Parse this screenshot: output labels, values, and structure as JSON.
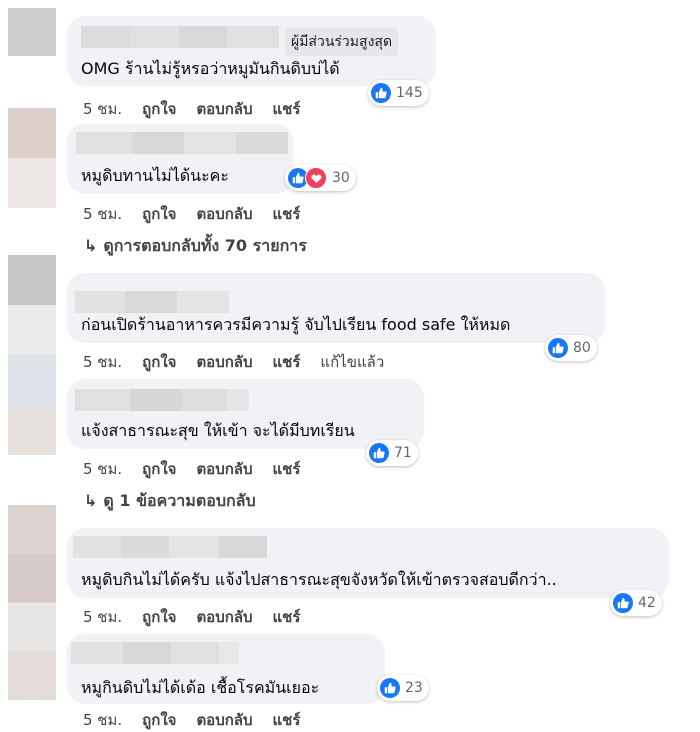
{
  "actions": {
    "time": "5 ชม.",
    "like": "ถูกใจ",
    "reply": "ตอบกลับ",
    "share": "แชร์",
    "edited": "แก้ไขแล้ว"
  },
  "icons": {
    "like": "thumbs-up-icon",
    "love": "heart-icon",
    "reply_arrow": "reply-arrow-icon"
  },
  "colors": {
    "like": "#1877f2",
    "love": "#f33e58",
    "bubble": "#f0f2f5"
  },
  "comments": [
    {
      "badge": "ผู้มีส่วนร่วมสูงสุด",
      "text": "OMG ร้านไม่รู้หรอว่าหมูมันกินดิบบ่ได้",
      "reactions": "145"
    },
    {
      "text": "หมูดิบทานไม่ได้นะคะ",
      "reactions": "30",
      "replies": "ดูการตอบกลับทั้ง 70 รายการ"
    },
    {
      "text": "ก่อนเปิดร้านอาหารควรมีความรู้ จับไปเรียน food safe ให้หมด",
      "reactions": "80"
    },
    {
      "text": "แจ้งสาธารณะสุข ให้เข้า จะได้มีบทเรียน",
      "reactions": "71",
      "replies": "ดู 1 ข้อความตอบกลับ"
    },
    {
      "text": "หมูดิบกินไม่ได้ครับ แจ้งไปสาธารณะสุขจังหวัดให้เข้าตรวจสอบดีกว่า..",
      "reactions": "42"
    },
    {
      "text": "หมูกินดิบไม่ได้เด้อ เชื้อโรคมันเยอะ",
      "reactions": "23"
    }
  ]
}
